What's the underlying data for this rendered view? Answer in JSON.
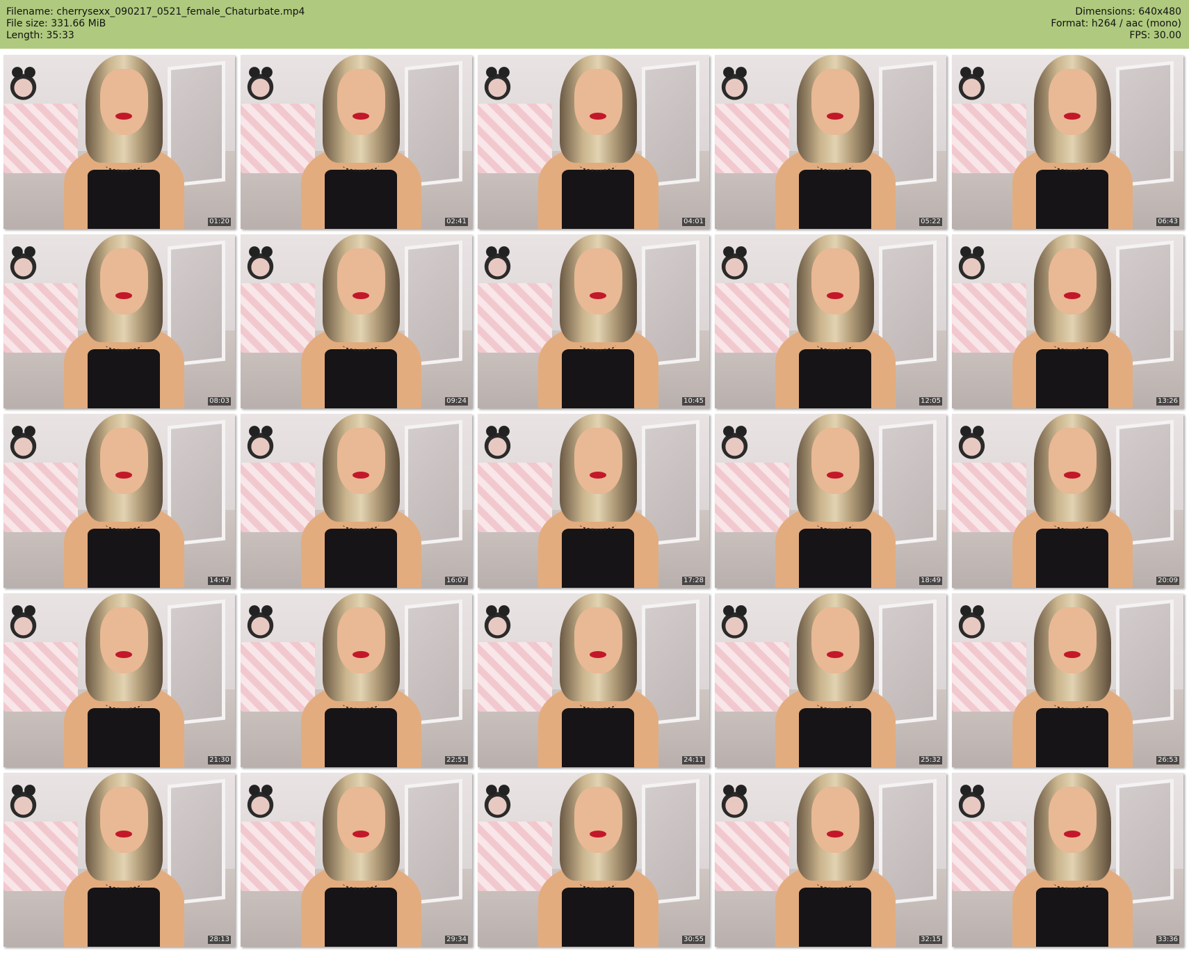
{
  "header": {
    "filename": "Filename: cherrysexx_090217_0521_female_Chaturbate.mp4",
    "filesize": "File size: 331.66 MiB",
    "length": "Length: 35:33",
    "dimensions": "Dimensions: 640x480",
    "format": "Format: h264 / aac (mono)",
    "fps": "FPS: 30.00",
    "background_color": "#afca7f"
  },
  "thumbnails": [
    {
      "timestamp": "01:20"
    },
    {
      "timestamp": "02:41"
    },
    {
      "timestamp": "04:01"
    },
    {
      "timestamp": "05:22"
    },
    {
      "timestamp": "06:43"
    },
    {
      "timestamp": "08:03"
    },
    {
      "timestamp": "09:24"
    },
    {
      "timestamp": "10:45"
    },
    {
      "timestamp": "12:05"
    },
    {
      "timestamp": "13:26"
    },
    {
      "timestamp": "14:47"
    },
    {
      "timestamp": "16:07"
    },
    {
      "timestamp": "17:28"
    },
    {
      "timestamp": "18:49"
    },
    {
      "timestamp": "20:09"
    },
    {
      "timestamp": "21:30"
    },
    {
      "timestamp": "22:51"
    },
    {
      "timestamp": "24:11"
    },
    {
      "timestamp": "25:32"
    },
    {
      "timestamp": "26:53"
    },
    {
      "timestamp": "28:13"
    },
    {
      "timestamp": "29:34"
    },
    {
      "timestamp": "30:55"
    },
    {
      "timestamp": "32:15"
    },
    {
      "timestamp": "33:36"
    }
  ]
}
